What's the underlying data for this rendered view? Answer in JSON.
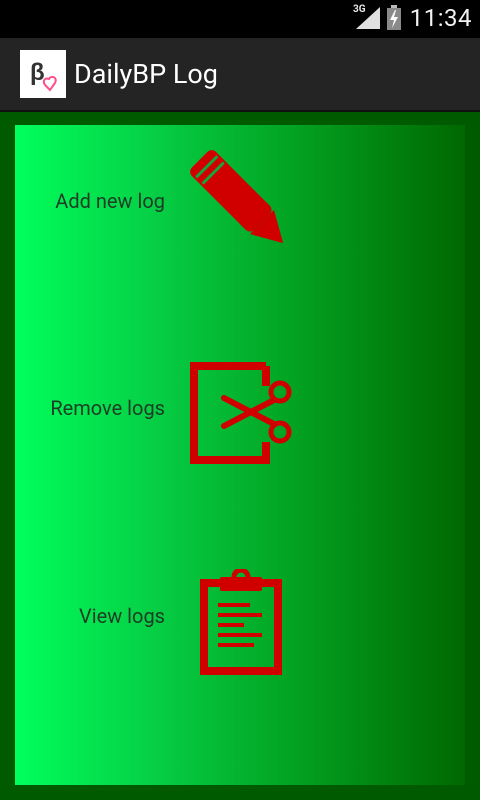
{
  "status_bar": {
    "network": "3G",
    "time": "11:34"
  },
  "action_bar": {
    "title": "DailyBP Log",
    "app_icon": "heart-logo-icon"
  },
  "menu": {
    "items": [
      {
        "label": "Add new log",
        "icon": "pencil-icon"
      },
      {
        "label": "Remove logs",
        "icon": "scissors-cut-icon"
      },
      {
        "label": "View logs",
        "icon": "clipboard-icon"
      }
    ]
  },
  "colors": {
    "icon_red": "#d00000",
    "label_text": "#1d3d25",
    "panel_gradient_start": "#00ff5c",
    "panel_gradient_end": "#006800",
    "frame": "#005a00"
  }
}
